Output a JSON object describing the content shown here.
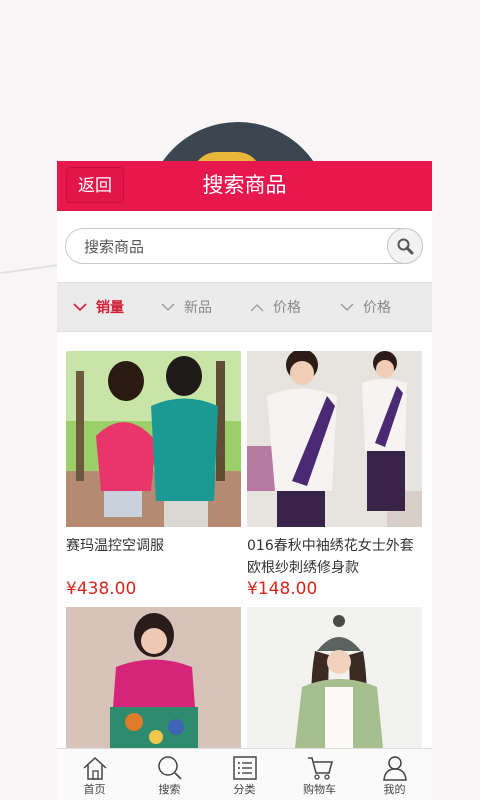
{
  "header": {
    "back_label": "返回",
    "title": "搜索商品"
  },
  "search": {
    "placeholder": "搜索商品"
  },
  "sort": {
    "items": [
      "销量",
      "新品",
      "价格",
      "价格"
    ]
  },
  "products": [
    {
      "name": "赛玛温控空调服",
      "price": "¥438.00"
    },
    {
      "name": "016春秋中袖绣花女士外套欧根纱刺绣修身款",
      "price": "¥148.00"
    },
    {
      "name": "",
      "price": ""
    },
    {
      "name": "",
      "price": ""
    }
  ],
  "tabbar": {
    "items": [
      "首页",
      "搜索",
      "分类",
      "购物车",
      "我的"
    ]
  },
  "icons": {
    "search": "search-icon",
    "sort_down": "chevron-down-icon",
    "sort_up": "chevron-up-icon",
    "home": "home-icon",
    "list": "list-icon",
    "cart": "cart-icon",
    "user": "user-icon"
  },
  "colors": {
    "brand": "#e6184e",
    "price": "#d9261c",
    "active_sort": "#d21f37"
  }
}
